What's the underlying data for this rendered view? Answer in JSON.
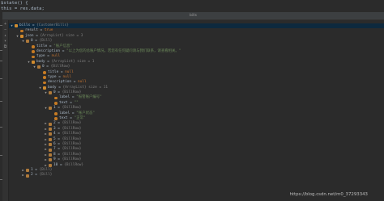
{
  "editor": {
    "line1": "$state() {",
    "line2": "this = res.data;"
  },
  "window": {
    "title": "bills"
  },
  "tree": [
    {
      "indent": 0,
      "arrow": "▼",
      "icon": "f",
      "key": "bills",
      "sep": " = ",
      "val": "{CustomerBills}",
      "vclass": "g",
      "sel": true
    },
    {
      "indent": 1,
      "arrow": "",
      "icon": "p",
      "key": "result",
      "sep": " = ",
      "val": "true",
      "vclass": "v"
    },
    {
      "indent": 1,
      "arrow": "▼",
      "icon": "f",
      "key": "json",
      "sep": " = ",
      "val": "{ArrayList} size = 3",
      "vclass": "g"
    },
    {
      "indent": 2,
      "arrow": "▼",
      "icon": "a",
      "key": "0",
      "sep": " = ",
      "val": "{Bill}",
      "vclass": "g"
    },
    {
      "indent": 3,
      "arrow": "",
      "icon": "p",
      "key": "title",
      "sep": " = ",
      "val": "\"账户信息\"",
      "vclass": "s"
    },
    {
      "indent": 3,
      "arrow": "",
      "icon": "p",
      "key": "description",
      "sep": " = ",
      "val": "\"以上为您的总账户情况，若您有任何疑问请与我们联系，请查看相关。\"",
      "vclass": "s"
    },
    {
      "indent": 3,
      "arrow": "",
      "icon": "p",
      "key": "type",
      "sep": " = ",
      "val": "null",
      "vclass": "v"
    },
    {
      "indent": 3,
      "arrow": "▼",
      "icon": "f",
      "key": "body",
      "sep": " = ",
      "val": "{ArrayList} size = 1",
      "vclass": "g"
    },
    {
      "indent": 4,
      "arrow": "▼",
      "icon": "a",
      "key": "0",
      "sep": " = ",
      "val": "{BillRow}",
      "vclass": "g"
    },
    {
      "indent": 5,
      "arrow": "",
      "icon": "p",
      "key": "title",
      "sep": " = ",
      "val": "null",
      "vclass": "v"
    },
    {
      "indent": 5,
      "arrow": "",
      "icon": "p",
      "key": "type",
      "sep": " = ",
      "val": "null",
      "vclass": "v"
    },
    {
      "indent": 5,
      "arrow": "",
      "icon": "p",
      "key": "description",
      "sep": " = ",
      "val": "null",
      "vclass": "v"
    },
    {
      "indent": 5,
      "arrow": "▼",
      "icon": "f",
      "key": "body",
      "sep": " = ",
      "val": "{ArrayList} size = 11",
      "vclass": "g"
    },
    {
      "indent": 6,
      "arrow": "▼",
      "icon": "a",
      "key": "0",
      "sep": " = ",
      "val": "{BillRow}",
      "vclass": "g"
    },
    {
      "indent": 7,
      "arrow": "",
      "icon": "p",
      "key": "label",
      "sep": " = ",
      "val": "\"报警账户编号\"",
      "vclass": "s"
    },
    {
      "indent": 7,
      "arrow": "",
      "icon": "p",
      "key": "text",
      "sep": " = ",
      "val": "\"\"",
      "vclass": "s"
    },
    {
      "indent": 6,
      "arrow": "▼",
      "icon": "a",
      "key": "1",
      "sep": " = ",
      "val": "{BillRow}",
      "vclass": "g"
    },
    {
      "indent": 7,
      "arrow": "",
      "icon": "p",
      "key": "label",
      "sep": " = ",
      "val": "\"账户状态\"",
      "vclass": "s"
    },
    {
      "indent": 7,
      "arrow": "",
      "icon": "p",
      "key": "text",
      "sep": " = ",
      "val": "\"正常\"",
      "vclass": "s"
    },
    {
      "indent": 6,
      "arrow": "▶",
      "icon": "a",
      "key": "2",
      "sep": " = ",
      "val": "{BillRow}",
      "vclass": "g"
    },
    {
      "indent": 6,
      "arrow": "▶",
      "icon": "a",
      "key": "3",
      "sep": " = ",
      "val": "{BillRow}",
      "vclass": "g"
    },
    {
      "indent": 6,
      "arrow": "▶",
      "icon": "a",
      "key": "4",
      "sep": " = ",
      "val": "{BillRow}",
      "vclass": "g"
    },
    {
      "indent": 6,
      "arrow": "▶",
      "icon": "a",
      "key": "5",
      "sep": " = ",
      "val": "{BillRow}",
      "vclass": "g"
    },
    {
      "indent": 6,
      "arrow": "▶",
      "icon": "a",
      "key": "6",
      "sep": " = ",
      "val": "{BillRow}",
      "vclass": "g"
    },
    {
      "indent": 6,
      "arrow": "▶",
      "icon": "a",
      "key": "7",
      "sep": " = ",
      "val": "{BillRow}",
      "vclass": "g"
    },
    {
      "indent": 6,
      "arrow": "▶",
      "icon": "a",
      "key": "8",
      "sep": " = ",
      "val": "{BillRow}",
      "vclass": "g"
    },
    {
      "indent": 6,
      "arrow": "▶",
      "icon": "a",
      "key": "9",
      "sep": " = ",
      "val": "{BillRow}",
      "vclass": "g"
    },
    {
      "indent": 6,
      "arrow": "▶",
      "icon": "a",
      "key": "10",
      "sep": " = ",
      "val": "{BillRow}",
      "vclass": "g"
    },
    {
      "indent": 2,
      "arrow": "▶",
      "icon": "a",
      "key": "1",
      "sep": " = ",
      "val": "{Bill}",
      "vclass": "g"
    },
    {
      "indent": 2,
      "arrow": "▶",
      "icon": "a",
      "key": "2",
      "sep": " = ",
      "val": "{Bill}",
      "vclass": "g"
    }
  ],
  "watermark": "https://blog.csdn.net/m0_37293343"
}
